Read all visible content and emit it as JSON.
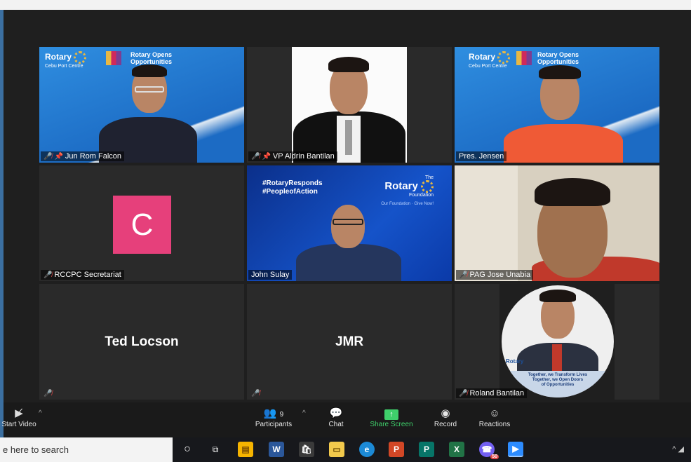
{
  "search": {
    "placeholder": "e here to search"
  },
  "tiles": [
    {
      "name": "Jun Rom Falcon",
      "muted": true,
      "pinned": true
    },
    {
      "name": "VP Aldrin Bantilan",
      "muted": true,
      "pinned": true
    },
    {
      "name": "Pres. Jensen",
      "muted": false,
      "pinned": false,
      "speaking": true
    },
    {
      "name": "RCCPC Secretariat",
      "muted": true,
      "avatar_letter": "C"
    },
    {
      "name": "John Sulay",
      "muted": false
    },
    {
      "name": "PAG Jose Unabia",
      "muted": true
    },
    {
      "name": "",
      "display_name": "Ted Locson",
      "muted": true
    },
    {
      "name": "",
      "display_name": "JMR",
      "muted": true
    },
    {
      "name": "Roland Bantilan",
      "muted": true
    }
  ],
  "rotary": {
    "brand": "Rotary",
    "club": "Cebu Port Centre",
    "tagline": "Rotary Opens Opportunities"
  },
  "foundation": {
    "hashtag1": "#RotaryResponds",
    "hashtag2": "#PeopleofAction",
    "the": "The",
    "brand": "Rotary",
    "sub": "Foundation",
    "slogan": "Our Foundation · Give Now!"
  },
  "roland_banner": {
    "line1": "Together, we Transform Lives",
    "line2": "Together, we Open Doors",
    "line3": "of Opportunities"
  },
  "toolbar": {
    "start_video": "Start Video",
    "participants": "Participants",
    "participants_count": "9",
    "chat": "Chat",
    "share_screen": "Share Screen",
    "record": "Record",
    "reactions": "Reactions"
  },
  "taskbar": {
    "viber_badge": "50"
  },
  "colors": {
    "speaking_border": "#cfe36d",
    "share_green": "#3fd16b",
    "avatar_pink": "#e6407b",
    "mute_red": "#e04848"
  }
}
